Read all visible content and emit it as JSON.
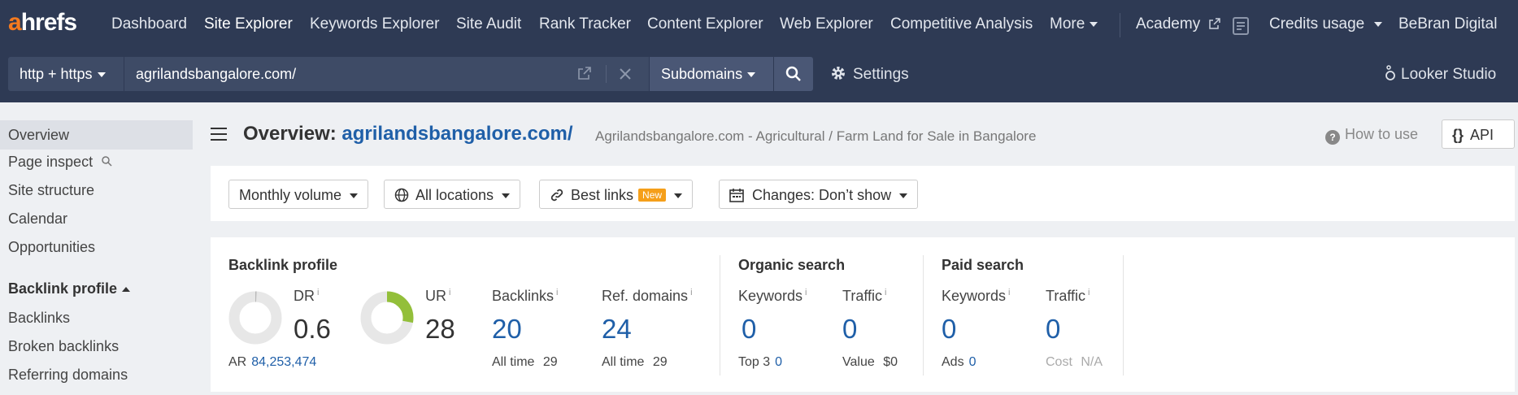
{
  "logo": {
    "a": "a",
    "rest": "hrefs"
  },
  "nav": {
    "items": [
      "Dashboard",
      "Site Explorer",
      "Keywords Explorer",
      "Site Audit",
      "Rank Tracker",
      "Content Explorer",
      "Web Explorer",
      "Competitive Analysis",
      "More"
    ],
    "academy": "Academy",
    "credits": "Credits usage",
    "account": "BeBran Digital"
  },
  "search": {
    "protocol": "http + https",
    "url": "agrilandsbangalore.com/",
    "mode": "Subdomains",
    "settings": "Settings",
    "looker": "Looker Studio"
  },
  "sidebar": {
    "items": [
      "Overview",
      "Page inspect",
      "Site structure",
      "Calendar",
      "Opportunities"
    ],
    "section": "Backlink profile",
    "section_items": [
      "Backlinks",
      "Broken backlinks",
      "Referring domains"
    ]
  },
  "header": {
    "title_prefix": "Overview:",
    "domain": "agrilandsbangalore.com/",
    "subtitle": "Agrilandsbangalore.com - Agricultural / Farm Land for Sale in Bangalore",
    "how_to": "How to use",
    "api": "API"
  },
  "filters": {
    "volume": "Monthly volume",
    "locations": "All locations",
    "best_links": "Best links",
    "new_badge": "New",
    "changes": "Changes: Don’t show"
  },
  "metrics": {
    "backlink_profile": {
      "title": "Backlink profile",
      "dr_label": "DR",
      "dr_value": "0.6",
      "dr_fraction": 0.006,
      "ar_label": "AR",
      "ar_value": "84,253,474",
      "ur_label": "UR",
      "ur_value": "28",
      "ur_fraction": 0.28,
      "backlinks_label": "Backlinks",
      "backlinks_value": "20",
      "backlinks_alltime_label": "All time",
      "backlinks_alltime": "29",
      "refdomains_label": "Ref. domains",
      "refdomains_value": "24",
      "refdomains_alltime_label": "All time",
      "refdomains_alltime": "29"
    },
    "organic": {
      "title": "Organic search",
      "keywords_label": "Keywords",
      "keywords_value": "0",
      "top3_label": "Top 3",
      "top3_value": "0",
      "traffic_label": "Traffic",
      "traffic_value": "0",
      "value_label": "Value",
      "value_value": "$0"
    },
    "paid": {
      "title": "Paid search",
      "keywords_label": "Keywords",
      "keywords_value": "0",
      "ads_label": "Ads",
      "ads_value": "0",
      "traffic_label": "Traffic",
      "traffic_value": "0",
      "cost_label": "Cost",
      "cost_value": "N/A"
    },
    "info_mark": "i"
  },
  "colors": {
    "nav_bg": "#2e3a54",
    "brand_orange": "#f47a1f",
    "link_blue": "#1f5fa8",
    "ur_green": "#93bf3a",
    "new_badge": "#f59f1a"
  }
}
